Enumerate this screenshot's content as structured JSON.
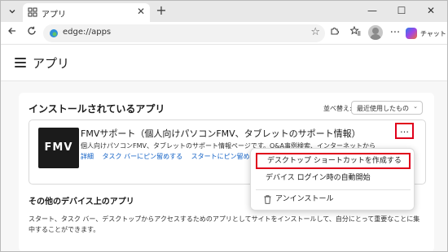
{
  "browser": {
    "tab_title": "アプリ",
    "new_tab_symbol": "+",
    "address": "edge://apps",
    "copilot_label": "チャット"
  },
  "page": {
    "title": "アプリ",
    "installed_heading": "インストールされているアプリ",
    "sort_label": "並べ替え:",
    "sort_value": "最近使用したもの",
    "app": {
      "logo_text": "FMV",
      "name": "FMVサポート（個人向けパソコンFMV、タブレットのサポート情報）",
      "description": "個人向けパソコンFMV、タブレットのサポート情報ページです。Q&A事例検索、インターネットから",
      "links": [
        "詳細",
        "タスク バーにピン留めする",
        "スタートにピン留め"
      ],
      "more_label": "…"
    },
    "other_heading": "その他のデバイス上のアプリ",
    "other_text": "スタート、タスク バー、デスクトップからアクセスするためのアプリとしてサイトをインストールして、自分にとって重要なことに集中することができます。"
  },
  "context_menu": {
    "items": [
      {
        "label": "デスクトップ ショートカットを作成する"
      },
      {
        "label": "デバイス ログイン時の自動開始"
      },
      {
        "label": "アンインストール"
      }
    ]
  },
  "colors": {
    "highlight": "#e0001b",
    "link": "#0f5fc4"
  }
}
